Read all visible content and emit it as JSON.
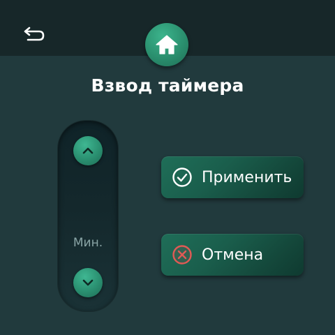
{
  "header": {
    "back_icon": "back-arrow-icon",
    "home_icon": "home-icon"
  },
  "title": "Взвод таймера",
  "stepper": {
    "unit_label": "Мин.",
    "up_icon": "chevron-up-icon",
    "down_icon": "chevron-down-icon"
  },
  "actions": {
    "apply_label": "Применить",
    "apply_icon": "check-circle-icon",
    "cancel_label": "Отмена",
    "cancel_icon": "cancel-circle-icon"
  },
  "colors": {
    "background": "#213a3d",
    "topbar": "#172729",
    "accent": "#2a8f6e",
    "button": "#1a5e4c",
    "cancel_icon": "#d9534f"
  }
}
